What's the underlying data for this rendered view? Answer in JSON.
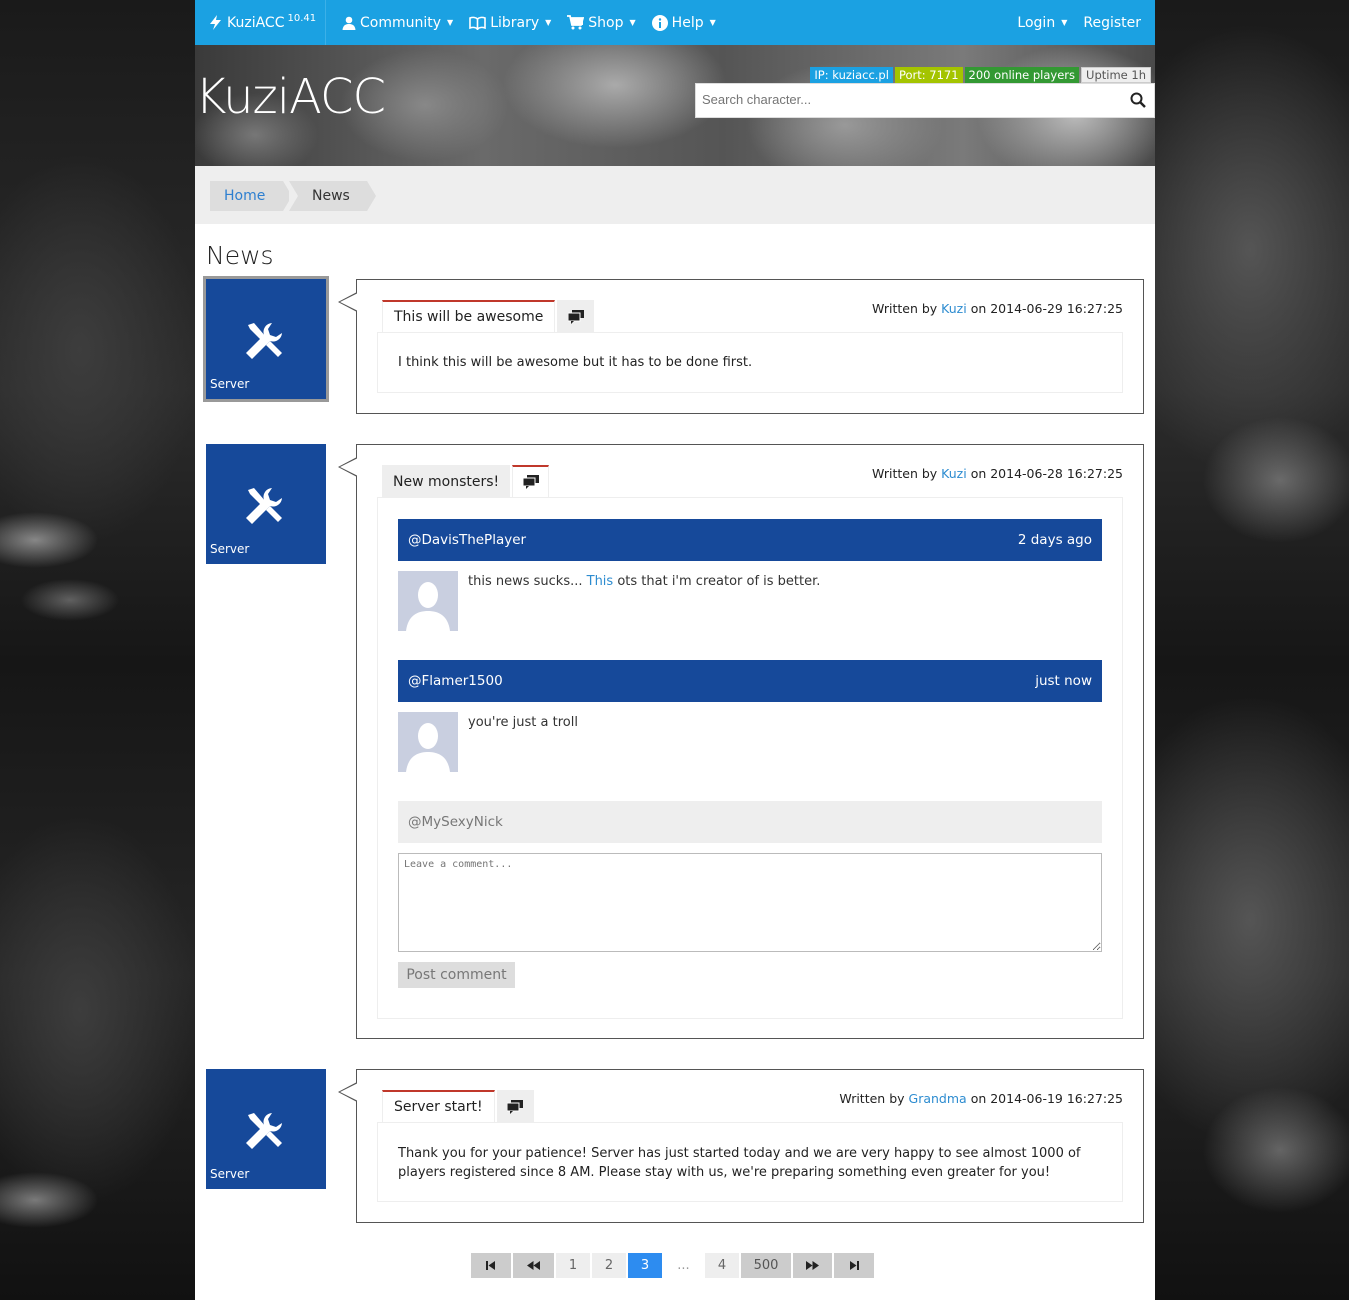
{
  "navbar": {
    "brand": "KuziACC",
    "version": "10.41",
    "items": [
      {
        "label": "Community",
        "icon": "user-icon"
      },
      {
        "label": "Library",
        "icon": "book-icon"
      },
      {
        "label": "Shop",
        "icon": "cart-icon"
      },
      {
        "label": "Help",
        "icon": "info-icon"
      }
    ],
    "login": "Login",
    "register": "Register"
  },
  "header": {
    "title": "KuziACC",
    "badges": {
      "ip": "IP: kuziacc.pl",
      "port": "Port: 7171",
      "online": "200 online players",
      "uptime": "Uptime 1h"
    },
    "search_placeholder": "Search character..."
  },
  "breadcrumb": {
    "home": "Home",
    "current": "News"
  },
  "page_title": "News",
  "news": [
    {
      "tile_label": "Server",
      "tab_title": "This will be awesome",
      "written_prefix": "Written by",
      "author": "Kuzi",
      "written_on": "on 2014-06-29 16:27:25",
      "body": "I think this will be awesome but it has to be done first."
    },
    {
      "tile_label": "Server",
      "tab_title": "New monsters!",
      "written_prefix": "Written by",
      "author": "Kuzi",
      "written_on": "on 2014-06-28 16:27:25",
      "comments": [
        {
          "user": "@DavisThePlayer",
          "time": "2 days ago",
          "text_before": "this news sucks... ",
          "link": "This",
          "text_after": " ots that i'm creator of is better."
        },
        {
          "user": "@Flamer1500",
          "time": "just now",
          "text": "you're just a troll"
        }
      ],
      "nick": "@MySexyNick",
      "comment_placeholder": "Leave a comment...",
      "post_button": "Post comment"
    },
    {
      "tile_label": "Server",
      "tab_title": "Server start!",
      "written_prefix": "Written by",
      "author": "Grandma",
      "written_on": "on 2014-06-19 16:27:25",
      "body": "Thank you for your patience! Server has just started today and we are very happy to see almost 1000 of players registered since 8 AM. Please stay with us, we're preparing something even greater for you!"
    }
  ],
  "pagination": {
    "pages": [
      "1",
      "2",
      "3",
      "...",
      "4",
      "500"
    ],
    "active": "3"
  },
  "colors": {
    "nav": "#1ba1e2",
    "tile": "#16499a",
    "tab_accent": "#c0382b",
    "link": "#2d8cd0"
  }
}
